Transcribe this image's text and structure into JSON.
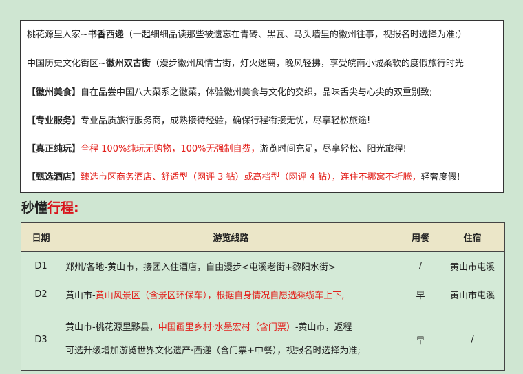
{
  "intro": {
    "line1": {
      "a": "桃花源里人家~",
      "b": "书香西递",
      "c": "（一起细细品读那些被遗忘在青砖、黑瓦、马头墙里的徽州往事，视报名时选择为准;）"
    },
    "line2": {
      "a": "中国历史文化街区~",
      "b": "徽州双古街",
      "c": "（漫步徽州风情古街，灯火迷离，晚风轻拂，享受皖南小城柔软的度假旅行时光"
    },
    "food": {
      "tag": "【徽州美食】",
      "text": "自在品尝中国八大菜系之徽菜，体验徽州美食与文化的交织，品味舌尖与心尖的双重别致;"
    },
    "service": {
      "tag": "【专业服务】",
      "text": "专业品质旅行服务商，成熟接待经验，确保行程衔接无忧，尽享轻松旅途!"
    },
    "pure": {
      "tag": "【真正纯玩】",
      "red": "全程 100%纯玩无购物，100%无强制自费，",
      "text": "游览时间充足，尽享轻松、阳光旅程!"
    },
    "hotel": {
      "tag": "【甄选酒店】",
      "red": "臻选市区商务酒店、舒适型（网评 3 钻）或高档型（网评 4 钻），连住不挪窝不折腾，",
      "text": "轻奢度假!"
    }
  },
  "section_title": {
    "black": "秒懂",
    "red": "行程:"
  },
  "table": {
    "headers": [
      "日期",
      "游览线路",
      "用餐",
      "住宿"
    ],
    "rows": [
      {
        "day": "D1",
        "route": "郑州/各地-黄山市，接团入住酒店，自由漫步<屯溪老街+黎阳水街>",
        "meal": "/",
        "stay": "黄山市屯溪"
      },
      {
        "day": "D2",
        "route_a": "黄山市-",
        "route_red": "黄山风景区（含景区环保车），根据自身情况自愿选乘缆车上下,",
        "meal": "早",
        "stay": "黄山市屯溪"
      },
      {
        "day": "D3",
        "route_a": "黄山市-桃花源里黟县，",
        "route_red": "中国画里乡村·水墨宏村（含门票）",
        "route_b": "-黄山市，返程",
        "route_line2": "可选升级增加游览世界文化遗产·西递（含门票+中餐），视报名时选择为准;",
        "meal": "早",
        "stay": "/"
      }
    ]
  }
}
